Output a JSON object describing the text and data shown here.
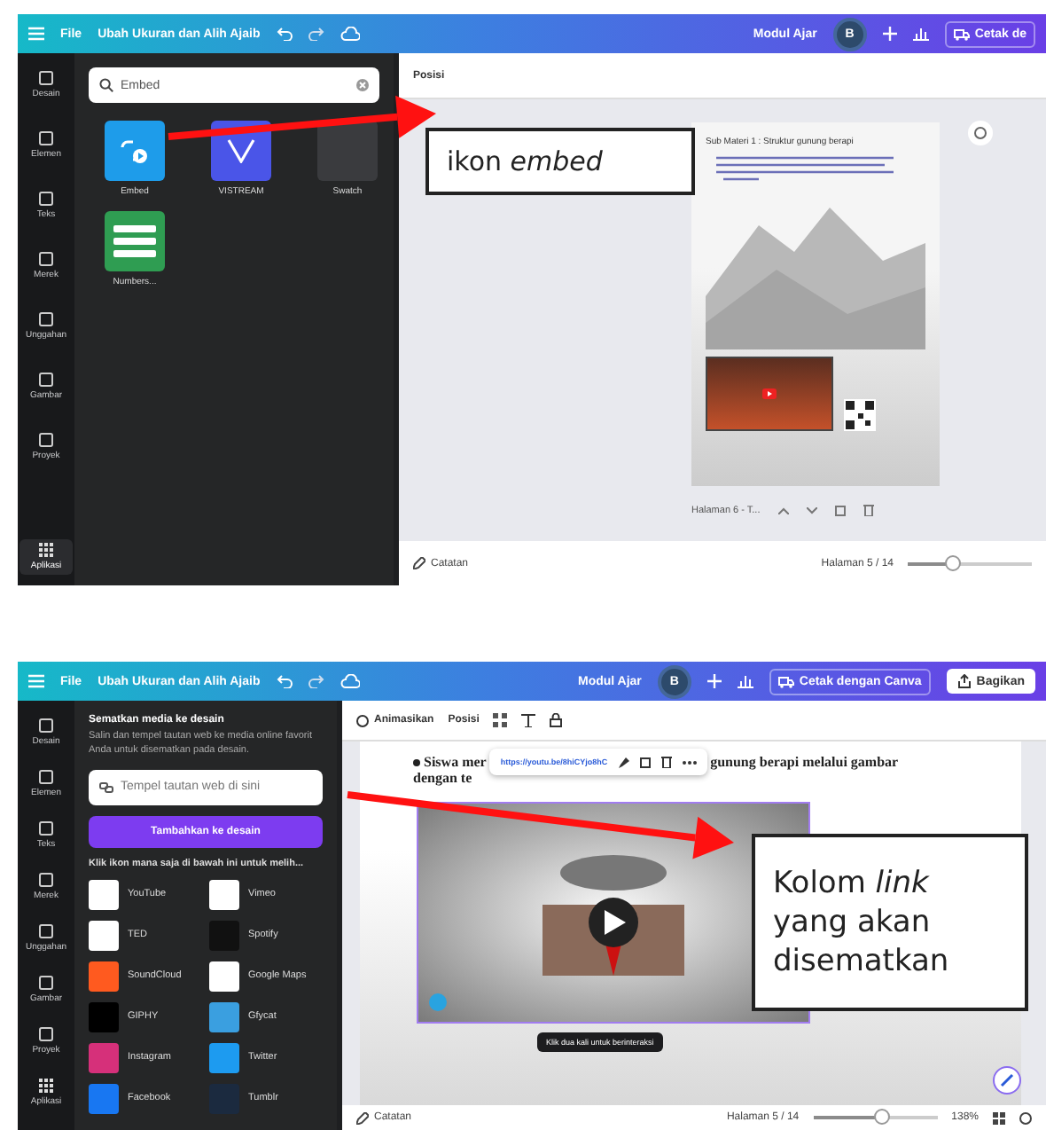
{
  "shots": [
    {
      "kind": "apps",
      "topbar": {
        "file": "File",
        "title": "Ubah Ukuran dan Alih Ajaib",
        "project": "Modul Ajar",
        "avatar": "B",
        "print": "Cetak de"
      },
      "rail": [
        {
          "label": "Desain",
          "selected": false
        },
        {
          "label": "Elemen",
          "selected": false
        },
        {
          "label": "Teks",
          "selected": false
        },
        {
          "label": "Merek",
          "selected": false
        },
        {
          "label": "Unggahan",
          "selected": false
        },
        {
          "label": "Gambar",
          "selected": false
        },
        {
          "label": "Proyek",
          "selected": false
        },
        {
          "label": "Aplikasi",
          "selected": true
        }
      ],
      "search": {
        "value": "Embed"
      },
      "apps": [
        {
          "name": "Embed",
          "color": "#1e9cea"
        },
        {
          "name": "VISTREAM",
          "color": "#4a55e8"
        },
        {
          "name": "Swatch",
          "color": "#3a3b3e"
        },
        {
          "name": "Numbers...",
          "color": "#2f9d52"
        }
      ],
      "toolbar": [
        "Posisi"
      ],
      "page": {
        "title": "Sub Materi 1 : Struktur gunung berapi",
        "header": "Halaman 6 - T..."
      },
      "footer": {
        "notes": "Catatan",
        "page": "Halaman 5 / 14",
        "level": 0.35
      },
      "callout": {
        "text": "ikon *embed*"
      }
    },
    {
      "kind": "embed",
      "topbar": {
        "file": "File",
        "title": "Ubah Ukuran dan Alih Ajaib",
        "project": "Modul Ajar",
        "avatar": "B",
        "print": "Cetak dengan Canva",
        "share": "Bagikan"
      },
      "rail": [
        {
          "label": "Desain",
          "selected": false
        },
        {
          "label": "Elemen",
          "selected": false
        },
        {
          "label": "Teks",
          "selected": false
        },
        {
          "label": "Merek",
          "selected": false
        },
        {
          "label": "Unggahan",
          "selected": false
        },
        {
          "label": "Gambar",
          "selected": false
        },
        {
          "label": "Proyek",
          "selected": false
        },
        {
          "label": "Aplikasi",
          "selected": false
        }
      ],
      "panel": {
        "heading": "Sematkan media ke desain",
        "description": "Salin dan tempel tautan web ke media online favorit Anda untuk disematkan pada desain.",
        "placeholder": "Tempel tautan web di sini",
        "button": "Tambahkan ke desain",
        "hint": "Klik ikon mana saja di bawah ini untuk melih...",
        "services": [
          {
            "name": "YouTube",
            "color": "#ffffff"
          },
          {
            "name": "Vimeo",
            "color": "#ffffff"
          },
          {
            "name": "TED",
            "color": "#ffffff"
          },
          {
            "name": "Spotify",
            "color": "#111111"
          },
          {
            "name": "SoundCloud",
            "color": "#ff5a1f"
          },
          {
            "name": "Google Maps",
            "color": "#ffffff"
          },
          {
            "name": "GIPHY",
            "color": "#000000"
          },
          {
            "name": "Gfycat",
            "color": "#3a9fe0"
          },
          {
            "name": "Instagram",
            "color": "#d6307a"
          },
          {
            "name": "Twitter",
            "color": "#1d9bf0"
          },
          {
            "name": "Facebook",
            "color": "#1877f2"
          },
          {
            "name": "Tumblr",
            "color": "#1b2a3f"
          }
        ]
      },
      "toolbar": [
        "Animasikan",
        "Posisi"
      ],
      "document": {
        "before": "Siswa mer",
        "after": "gunung berapi melalui gambar",
        "line2": "dengan te",
        "link": "https://youtu.be/8hiCYjo8hC",
        "tooltip": "Klik dua kali untuk berinteraksi"
      },
      "footer": {
        "notes": "Catatan",
        "page": "Halaman 5 / 14",
        "zoom": "138%",
        "level": 0.55
      },
      "callout": {
        "text": "Kolom *link* yang akan disematkan"
      }
    }
  ]
}
